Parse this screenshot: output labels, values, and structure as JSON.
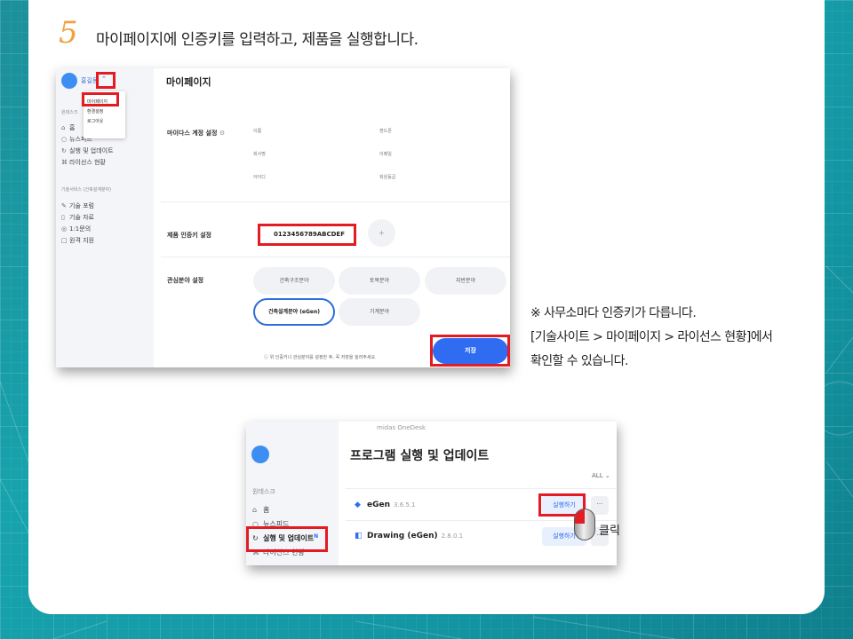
{
  "step": {
    "number": "5",
    "text": "마이페이지에 인증키를 입력하고, 제품을 실행합니다."
  },
  "mypage": {
    "user_name": "홍길동",
    "dropdown": [
      "마이페이지",
      "환경설정",
      "로그아웃"
    ],
    "section_onedesk": "원데스크",
    "nav": [
      "홈",
      "뉴스피드",
      "실행 및 업데이트",
      "라이선스 현황"
    ],
    "section_tech": "기술서비스 (건축설계분야)",
    "nav2": [
      "기술 포럼",
      "기술 자료",
      "1:1문의",
      "원격 지원"
    ],
    "title": "마이페이지",
    "account_label": "마이다스 계정 설정",
    "fields": [
      "이름",
      "핸드폰",
      "회사명",
      "이메일",
      "아이디",
      "회원등급"
    ],
    "key_label": "제품 인증키 설정",
    "key_value": "0123456789ABCDEF",
    "plus": "+",
    "interest_label": "관심분야 설정",
    "interests": [
      "건축구조분야",
      "토목분야",
      "지반분야",
      "건축설계분야 (eGen)",
      "기계분야"
    ],
    "note": "ⓘ 위 인증키나 관심분야를 설정한 후, 꼭 저장을 눌러주세요.",
    "save": "저장"
  },
  "notes": {
    "line1": "※ 사무소마다 인증키가 다릅니다.",
    "line2": "[기술사이트 > 마이페이지 > 라이선스 현황]에서",
    "line3": "확인할 수 있습니다."
  },
  "onedesk": {
    "app_title": "midas OneDesk",
    "section": "원데스크",
    "nav": [
      "홈",
      "뉴스피드",
      "실행 및 업데이트",
      "라이선스 현황"
    ],
    "new_badge": "N",
    "title": "프로그램 실행 및 업데이트",
    "filter": "ALL ⌄",
    "products": [
      {
        "name": "eGen",
        "version": "3.6.5.1",
        "run": "실행하기",
        "more": "···"
      },
      {
        "name": "Drawing (eGen)",
        "version": "2.8.0.1",
        "run": "실행하기",
        "more": "···"
      }
    ],
    "click_label": "클릭"
  }
}
